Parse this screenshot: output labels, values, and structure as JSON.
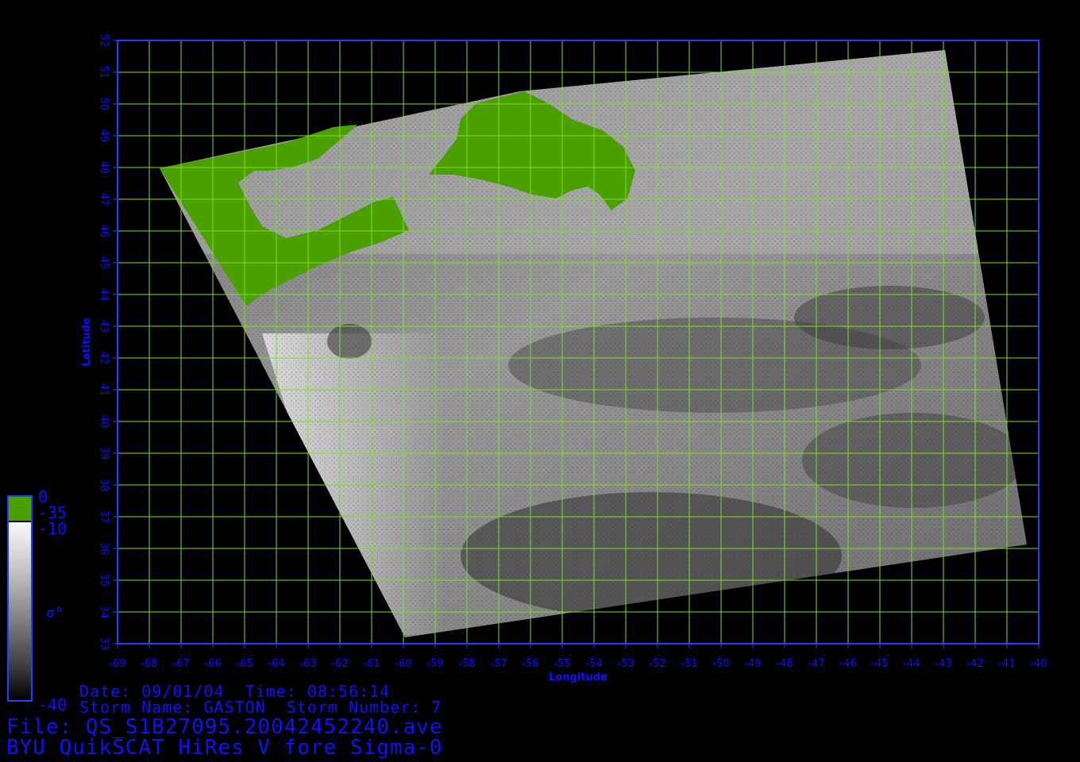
{
  "map": {
    "lon_ticks": [
      "-69",
      "-68",
      "-67",
      "-66",
      "-65",
      "-64",
      "-63",
      "-62",
      "-61",
      "-60",
      "-59",
      "-58",
      "-57",
      "-56",
      "-55",
      "-54",
      "-53",
      "-52",
      "-51",
      "-50",
      "-49",
      "-48",
      "-47",
      "-46",
      "-45",
      "-44",
      "-43",
      "-42",
      "-41",
      "-40"
    ],
    "lat_ticks": [
      "33",
      "34",
      "35",
      "36",
      "37",
      "38",
      "39",
      "40",
      "41",
      "42",
      "43",
      "44",
      "45",
      "46",
      "47",
      "48",
      "49",
      "50",
      "51",
      "52"
    ],
    "lon_range": [
      -69,
      -40
    ],
    "lat_range": [
      33,
      52
    ],
    "xlabel": "Longitude",
    "ylabel": "Latitude",
    "grid": true,
    "colors": {
      "frame": "#2040ff",
      "grid": "#7ce020",
      "land": "#4aa000",
      "labels": "#1010ff",
      "background": "#000000"
    }
  },
  "legend": {
    "top_value": "0",
    "land_value": "-35",
    "high_value": "-10",
    "symbol": "σ°",
    "bottom_value": "-40"
  },
  "info": {
    "date_time": "Date: 09/01/04  Time: 08:56:14",
    "storm": "Storm Name: GASTON  Storm Number: 7",
    "file": "File: QS_S1B27095.20042452240.ave",
    "product": "BYU QuikSCAT HiRes V fore Sigma-0"
  }
}
